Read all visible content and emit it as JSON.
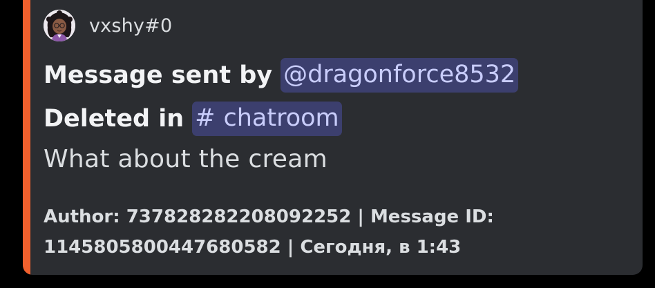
{
  "embed": {
    "accent_color": "#f1602d",
    "author": {
      "name": "vxshy#0",
      "avatar_icon": "avatar-icon"
    },
    "title_line1": {
      "prefix": "Message sent by",
      "mention": "@dragonforce8532"
    },
    "title_line2": {
      "prefix": "Deleted in",
      "channel_hash": "#",
      "channel_name": "chatroom"
    },
    "description": "What about the cream",
    "footer": "Author: 737828282208092252 | Message ID: 1145805800447680582 | Сегодня, в 1:43"
  }
}
